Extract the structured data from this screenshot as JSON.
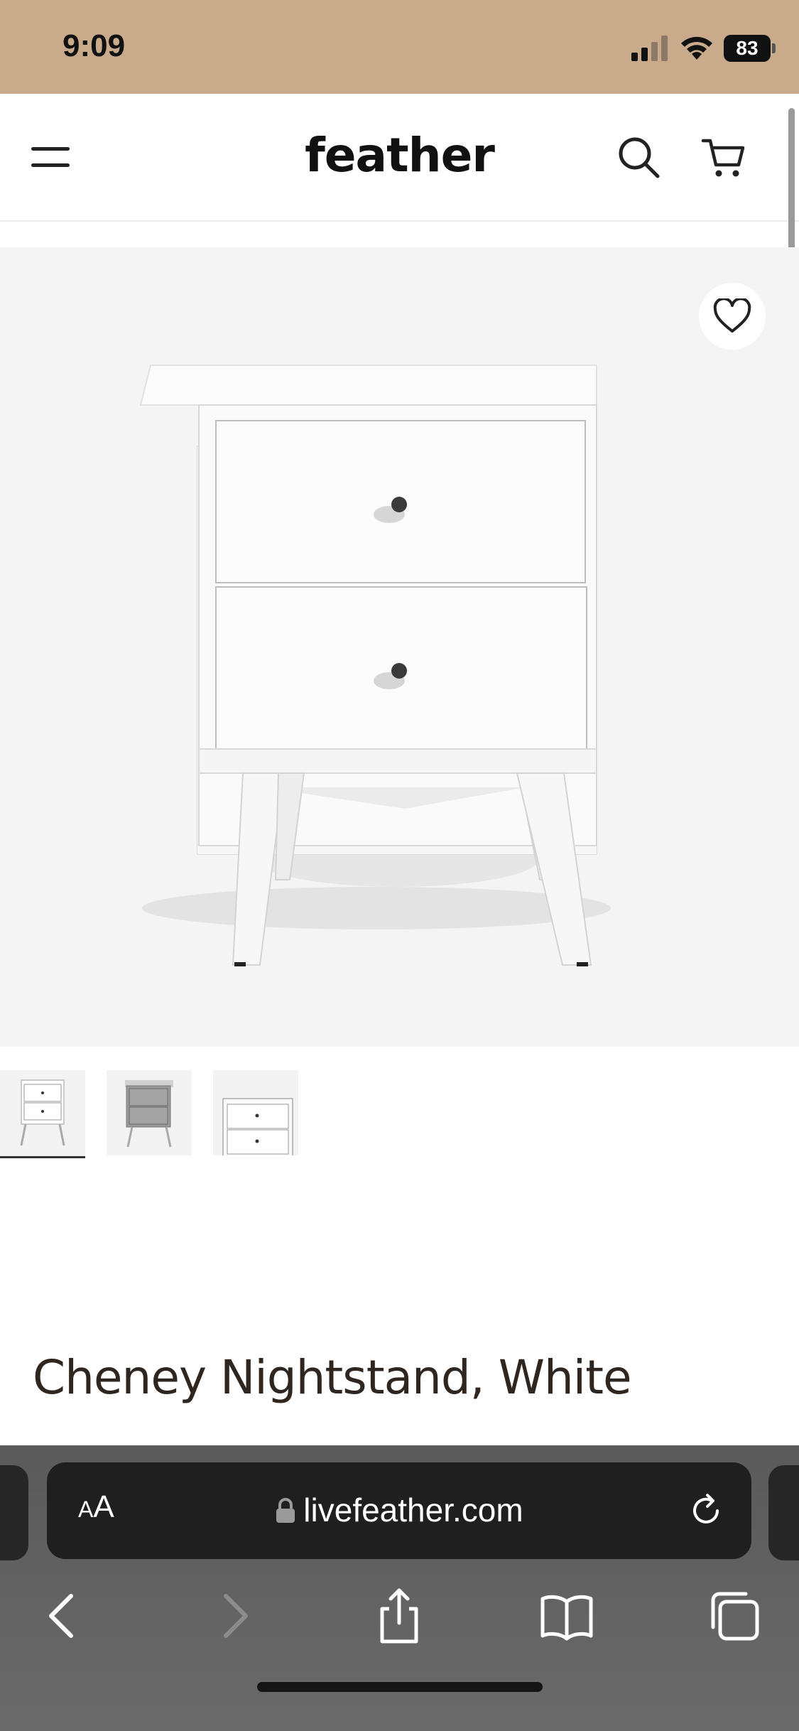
{
  "status": {
    "time": "9:09",
    "battery": "83"
  },
  "header": {
    "logo": "feather",
    "icons": [
      "menu-icon",
      "search-icon",
      "cart-icon"
    ]
  },
  "product": {
    "title": "Cheney Nightstand, White",
    "thumbnail_count": 3,
    "active_thumbnail": 1
  },
  "browser": {
    "aa_label_small": "A",
    "aa_label_large": "A",
    "url": "livefeather.com",
    "colors": {
      "url_bar": "#1f1f1f",
      "toolbar": "#5f5f5f",
      "status_bar": "#c9ab8c"
    }
  }
}
